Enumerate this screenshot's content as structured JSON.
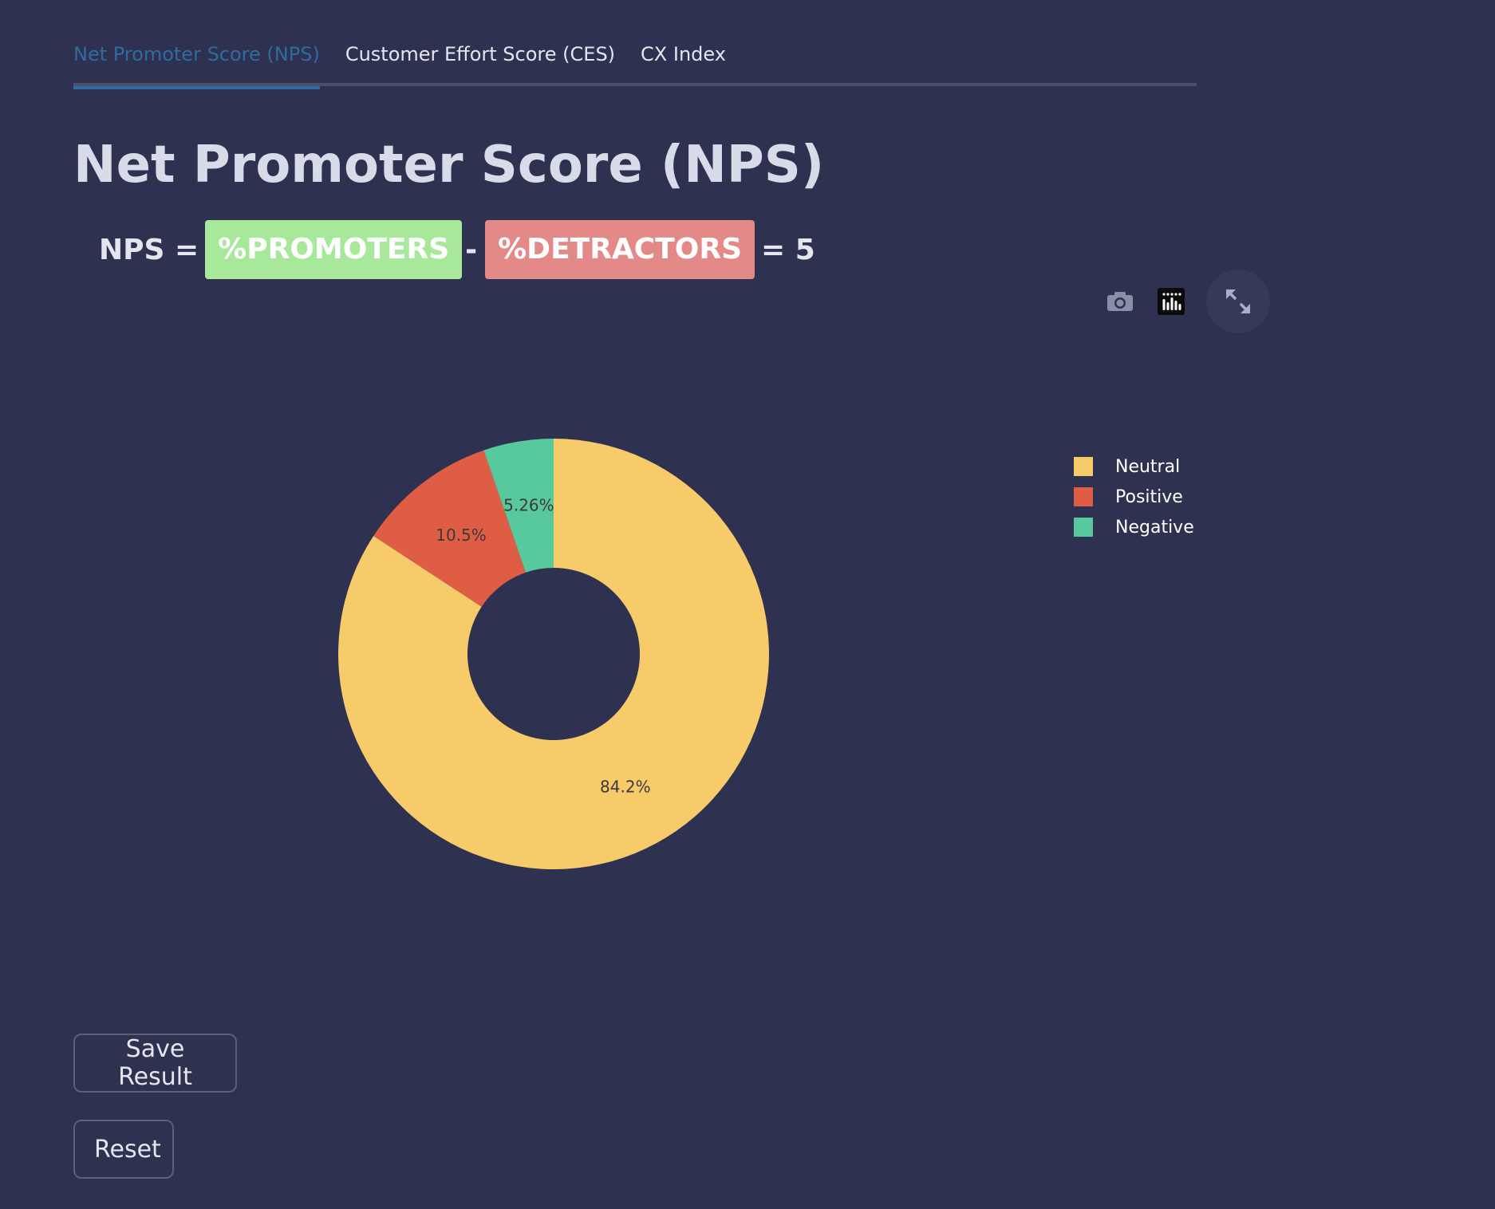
{
  "tabs": [
    {
      "label": "Net Promoter Score (NPS)",
      "active": true
    },
    {
      "label": "Customer Effort Score (CES)",
      "active": false
    },
    {
      "label": "CX Index",
      "active": false
    }
  ],
  "page_title": "Net Promoter Score (NPS)",
  "formula": {
    "prefix": "NPS =",
    "promoters": "%PROMOTERS",
    "minus": "-",
    "detractors": "%DETRACTORS",
    "result": "= 5",
    "colors": {
      "promoters_bg": "#a8e89a",
      "detractors_bg": "#e38a88"
    }
  },
  "toolbar": {
    "icons": [
      "camera-icon",
      "plotly-logo-icon",
      "expand-icon"
    ]
  },
  "chart_data": {
    "type": "pie",
    "hole": true,
    "labels": [
      "Neutral",
      "Positive",
      "Negative"
    ],
    "values": [
      84.2,
      10.5,
      5.26
    ],
    "value_labels": [
      "84.2%",
      "10.5%",
      "5.26%"
    ],
    "colors": [
      "#f7ca6a",
      "#e05d45",
      "#58c99c"
    ],
    "direction": "clockwise",
    "start": "top",
    "legend_position": "right"
  },
  "buttons": {
    "save": "Save Result",
    "reset": "Reset"
  },
  "theme": {
    "background": "#2e3250",
    "accent": "#2f6aa0"
  }
}
